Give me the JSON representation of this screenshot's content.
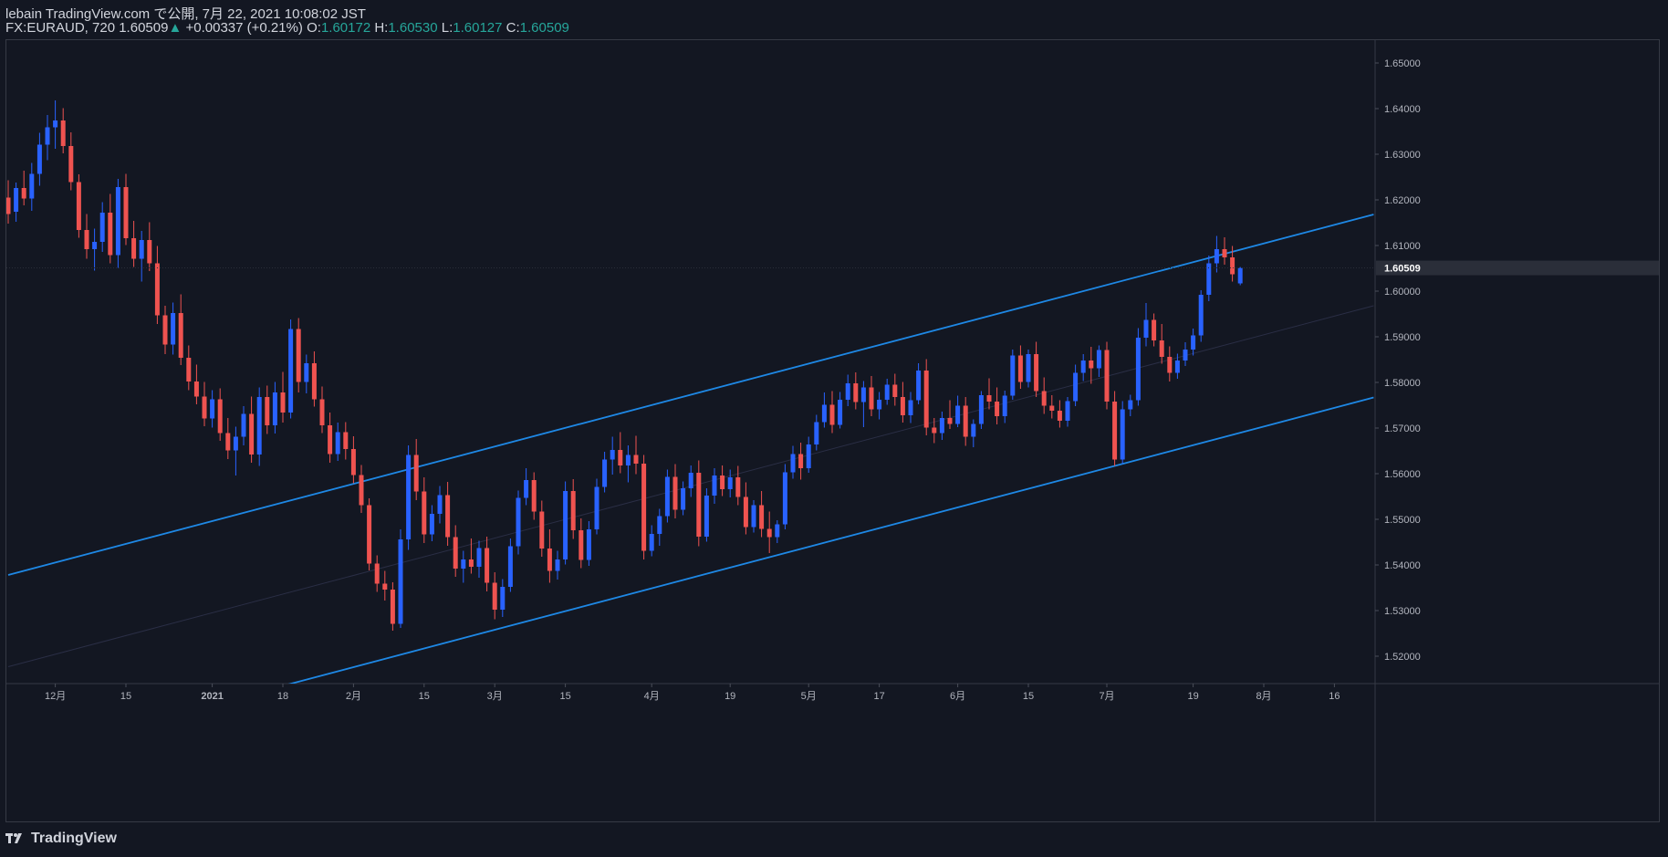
{
  "header": {
    "line1": "lebain TradingView.com で公開, 7月 22, 2021 10:08:02 JST",
    "symbol": "FX:EURAUD, 720",
    "last": "1.60509",
    "arrow": "▲",
    "change": "+0.00337 (+0.21%)",
    "o_label": "O:",
    "o_val": "1.60172",
    "h_label": "H:",
    "h_val": "1.60530",
    "l_label": "L:",
    "l_val": "1.60127",
    "c_label": "C:",
    "c_val": "1.60509"
  },
  "footer": {
    "brand": "TradingView"
  },
  "colors": {
    "background": "#131722",
    "up_candle": "#2962ff",
    "down_candle": "#ef5350",
    "channel": "#1e88e5",
    "price_badge": "#2a2e39"
  },
  "chart_data": {
    "type": "candlestick",
    "symbol": "FX:EURAUD",
    "interval": "720",
    "last_price": 1.60509,
    "y_range": [
      1.514,
      1.655
    ],
    "y_ticks": [
      "1.65000",
      "1.64000",
      "1.63000",
      "1.62000",
      "1.61000",
      "1.60000",
      "1.59000",
      "1.58000",
      "1.57000",
      "1.56000",
      "1.55000",
      "1.54000",
      "1.53000",
      "1.52000"
    ],
    "y_tick_values": [
      1.65,
      1.64,
      1.63,
      1.62,
      1.61,
      1.6,
      1.59,
      1.58,
      1.57,
      1.56,
      1.55,
      1.54,
      1.53,
      1.52
    ],
    "x_ticks": [
      {
        "label": "12月",
        "i": 6
      },
      {
        "label": "15",
        "i": 15
      },
      {
        "label": "2021",
        "i": 26
      },
      {
        "label": "18",
        "i": 35
      },
      {
        "label": "2月",
        "i": 44
      },
      {
        "label": "15",
        "i": 53
      },
      {
        "label": "3月",
        "i": 62
      },
      {
        "label": "15",
        "i": 71
      },
      {
        "label": "4月",
        "i": 82
      },
      {
        "label": "19",
        "i": 92
      },
      {
        "label": "5月",
        "i": 102
      },
      {
        "label": "17",
        "i": 111
      },
      {
        "label": "6月",
        "i": 121
      },
      {
        "label": "15",
        "i": 130
      },
      {
        "label": "7月",
        "i": 140
      },
      {
        "label": "19",
        "i": 151
      },
      {
        "label": "8月",
        "i": 160
      },
      {
        "label": "16",
        "i": 169
      }
    ],
    "bars": [
      [
        1.6205,
        1.6243,
        1.6148,
        1.6169
      ],
      [
        1.6174,
        1.6238,
        1.6152,
        1.6226
      ],
      [
        1.6226,
        1.6264,
        1.6188,
        1.6203
      ],
      [
        1.6203,
        1.6281,
        1.6176,
        1.6257
      ],
      [
        1.6257,
        1.6347,
        1.6231,
        1.6321
      ],
      [
        1.6321,
        1.6386,
        1.6287,
        1.6359
      ],
      [
        1.6359,
        1.6418,
        1.6312,
        1.6374
      ],
      [
        1.6374,
        1.6401,
        1.6302,
        1.6318
      ],
      [
        1.6318,
        1.6348,
        1.6221,
        1.6239
      ],
      [
        1.6239,
        1.6256,
        1.6117,
        1.6134
      ],
      [
        1.6134,
        1.6169,
        1.6071,
        1.6092
      ],
      [
        1.6092,
        1.6137,
        1.6045,
        1.6108
      ],
      [
        1.6108,
        1.6195,
        1.6086,
        1.6172
      ],
      [
        1.6172,
        1.6213,
        1.6061,
        1.6079
      ],
      [
        1.6079,
        1.6246,
        1.6051,
        1.6228
      ],
      [
        1.6228,
        1.6257,
        1.6101,
        1.6116
      ],
      [
        1.6116,
        1.6154,
        1.6053,
        1.6071
      ],
      [
        1.6071,
        1.6132,
        1.6021,
        1.6112
      ],
      [
        1.6112,
        1.6151,
        1.6044,
        1.6061
      ],
      [
        1.6061,
        1.6099,
        1.5928,
        1.5947
      ],
      [
        1.5947,
        1.5968,
        1.5862,
        1.5883
      ],
      [
        1.5883,
        1.5975,
        1.5861,
        1.5952
      ],
      [
        1.5952,
        1.5993,
        1.5838,
        1.5854
      ],
      [
        1.5854,
        1.5881,
        1.5783,
        1.5802
      ],
      [
        1.5802,
        1.5839,
        1.5752,
        1.5769
      ],
      [
        1.5769,
        1.5801,
        1.5704,
        1.5721
      ],
      [
        1.5721,
        1.5783,
        1.5701,
        1.5763
      ],
      [
        1.5763,
        1.5787,
        1.5672,
        1.5689
      ],
      [
        1.5689,
        1.5722,
        1.5632,
        1.5651
      ],
      [
        1.5651,
        1.5703,
        1.5596,
        1.5681
      ],
      [
        1.5681,
        1.5748,
        1.5662,
        1.5731
      ],
      [
        1.5731,
        1.5769,
        1.5624,
        1.5642
      ],
      [
        1.5642,
        1.5789,
        1.5617,
        1.5768
      ],
      [
        1.5768,
        1.5793,
        1.5687,
        1.5706
      ],
      [
        1.5706,
        1.5801,
        1.5688,
        1.5778
      ],
      [
        1.5778,
        1.5823,
        1.5712,
        1.5734
      ],
      [
        1.5734,
        1.5938,
        1.5721,
        1.5917
      ],
      [
        1.5917,
        1.5941,
        1.5778,
        1.5801
      ],
      [
        1.5801,
        1.5861,
        1.5776,
        1.5842
      ],
      [
        1.5842,
        1.5868,
        1.5747,
        1.5763
      ],
      [
        1.5763,
        1.5791,
        1.5689,
        1.5706
      ],
      [
        1.5706,
        1.5734,
        1.5624,
        1.5643
      ],
      [
        1.5643,
        1.5712,
        1.5628,
        1.5691
      ],
      [
        1.5691,
        1.5713,
        1.5631,
        1.5654
      ],
      [
        1.5654,
        1.5682,
        1.5579,
        1.5597
      ],
      [
        1.5597,
        1.5619,
        1.5514,
        1.5531
      ],
      [
        1.5531,
        1.5546,
        1.5388,
        1.5403
      ],
      [
        1.5403,
        1.5421,
        1.5341,
        1.5359
      ],
      [
        1.5359,
        1.5387,
        1.5322,
        1.5346
      ],
      [
        1.5346,
        1.5362,
        1.5256,
        1.5271
      ],
      [
        1.5271,
        1.5478,
        1.5262,
        1.5456
      ],
      [
        1.5456,
        1.5662,
        1.5433,
        1.5641
      ],
      [
        1.5641,
        1.5676,
        1.5542,
        1.5561
      ],
      [
        1.5561,
        1.5592,
        1.5448,
        1.5467
      ],
      [
        1.5467,
        1.5531,
        1.5452,
        1.5512
      ],
      [
        1.5512,
        1.5573,
        1.5491,
        1.5553
      ],
      [
        1.5553,
        1.5582,
        1.5442,
        1.5461
      ],
      [
        1.5461,
        1.5487,
        1.5374,
        1.5392
      ],
      [
        1.5392,
        1.5431,
        1.5361,
        1.5412
      ],
      [
        1.5412,
        1.5458,
        1.5381,
        1.5396
      ],
      [
        1.5396,
        1.5453,
        1.5372,
        1.5437
      ],
      [
        1.5437,
        1.5462,
        1.5342,
        1.5361
      ],
      [
        1.5361,
        1.5384,
        1.5281,
        1.5302
      ],
      [
        1.5302,
        1.5369,
        1.5286,
        1.5352
      ],
      [
        1.5352,
        1.5458,
        1.5341,
        1.5441
      ],
      [
        1.5441,
        1.5563,
        1.5423,
        1.5547
      ],
      [
        1.5547,
        1.5612,
        1.5531,
        1.5586
      ],
      [
        1.5586,
        1.5603,
        1.5499,
        1.5517
      ],
      [
        1.5517,
        1.5541,
        1.5418,
        1.5436
      ],
      [
        1.5436,
        1.5478,
        1.5361,
        1.5387
      ],
      [
        1.5387,
        1.5431,
        1.5368,
        1.5412
      ],
      [
        1.5412,
        1.5583,
        1.5401,
        1.5562
      ],
      [
        1.5562,
        1.5588,
        1.5457,
        1.5476
      ],
      [
        1.5476,
        1.5502,
        1.5393,
        1.5411
      ],
      [
        1.5411,
        1.5496,
        1.5398,
        1.5478
      ],
      [
        1.5478,
        1.5589,
        1.5467,
        1.5571
      ],
      [
        1.5571,
        1.5648,
        1.5559,
        1.5631
      ],
      [
        1.5631,
        1.5681,
        1.5598,
        1.5652
      ],
      [
        1.5652,
        1.5691,
        1.5601,
        1.5618
      ],
      [
        1.5618,
        1.5662,
        1.5581,
        1.5641
      ],
      [
        1.5641,
        1.5683,
        1.5599,
        1.5622
      ],
      [
        1.5622,
        1.5641,
        1.5412,
        1.5431
      ],
      [
        1.5431,
        1.5487,
        1.5419,
        1.5468
      ],
      [
        1.5468,
        1.5523,
        1.5442,
        1.5507
      ],
      [
        1.5507,
        1.5609,
        1.5493,
        1.5593
      ],
      [
        1.5593,
        1.5621,
        1.5502,
        1.5521
      ],
      [
        1.5521,
        1.5583,
        1.5509,
        1.5568
      ],
      [
        1.5568,
        1.5618,
        1.5549,
        1.5602
      ],
      [
        1.5602,
        1.5629,
        1.5441,
        1.5462
      ],
      [
        1.5462,
        1.5568,
        1.5451,
        1.5552
      ],
      [
        1.5552,
        1.5612,
        1.5534,
        1.5596
      ],
      [
        1.5596,
        1.5618,
        1.5551,
        1.5566
      ],
      [
        1.5566,
        1.5609,
        1.5548,
        1.5592
      ],
      [
        1.5592,
        1.5617,
        1.5531,
        1.5549
      ],
      [
        1.5549,
        1.5581,
        1.5467,
        1.5483
      ],
      [
        1.5483,
        1.5542,
        1.5471,
        1.5531
      ],
      [
        1.5531,
        1.5562,
        1.5461,
        1.5479
      ],
      [
        1.5479,
        1.5517,
        1.5426,
        1.5461
      ],
      [
        1.5461,
        1.5498,
        1.5448,
        1.5489
      ],
      [
        1.5489,
        1.5621,
        1.5478,
        1.5603
      ],
      [
        1.5603,
        1.5661,
        1.5589,
        1.5643
      ],
      [
        1.5643,
        1.5668,
        1.5587,
        1.5612
      ],
      [
        1.5612,
        1.5681,
        1.5602,
        1.5664
      ],
      [
        1.5664,
        1.5729,
        1.5651,
        1.5713
      ],
      [
        1.5713,
        1.5778,
        1.5701,
        1.5751
      ],
      [
        1.5751,
        1.5781,
        1.5689,
        1.5707
      ],
      [
        1.5707,
        1.5779,
        1.5699,
        1.5762
      ],
      [
        1.5762,
        1.5817,
        1.5748,
        1.5798
      ],
      [
        1.5798,
        1.5822,
        1.5741,
        1.5757
      ],
      [
        1.5757,
        1.5803,
        1.5702,
        1.5789
      ],
      [
        1.5789,
        1.5814,
        1.5726,
        1.5741
      ],
      [
        1.5741,
        1.5779,
        1.5719,
        1.5762
      ],
      [
        1.5762,
        1.5808,
        1.5751,
        1.5795
      ],
      [
        1.5795,
        1.5819,
        1.5749,
        1.5768
      ],
      [
        1.5768,
        1.5801,
        1.5712,
        1.5728
      ],
      [
        1.5728,
        1.5779,
        1.5711,
        1.5761
      ],
      [
        1.5761,
        1.5842,
        1.5752,
        1.5826
      ],
      [
        1.5826,
        1.5851,
        1.5684,
        1.5701
      ],
      [
        1.5701,
        1.5722,
        1.5667,
        1.5689
      ],
      [
        1.5689,
        1.5736,
        1.5674,
        1.5722
      ],
      [
        1.5722,
        1.5761,
        1.5698,
        1.5709
      ],
      [
        1.5709,
        1.5771,
        1.5702,
        1.5749
      ],
      [
        1.5749,
        1.5768,
        1.5661,
        1.5681
      ],
      [
        1.5681,
        1.5719,
        1.5658,
        1.5709
      ],
      [
        1.5709,
        1.5781,
        1.5698,
        1.5772
      ],
      [
        1.5772,
        1.5809,
        1.5741,
        1.5758
      ],
      [
        1.5758,
        1.5789,
        1.5708,
        1.5726
      ],
      [
        1.5726,
        1.5782,
        1.5711,
        1.5771
      ],
      [
        1.5771,
        1.5872,
        1.5762,
        1.5859
      ],
      [
        1.5859,
        1.5881,
        1.5786,
        1.5801
      ],
      [
        1.5801,
        1.5872,
        1.5789,
        1.5862
      ],
      [
        1.5862,
        1.5889,
        1.5768,
        1.5781
      ],
      [
        1.5781,
        1.5811,
        1.5731,
        1.5749
      ],
      [
        1.5749,
        1.5772,
        1.5721,
        1.5738
      ],
      [
        1.5738,
        1.5761,
        1.5701,
        1.5716
      ],
      [
        1.5716,
        1.5768,
        1.5703,
        1.5759
      ],
      [
        1.5759,
        1.5839,
        1.5748,
        1.5821
      ],
      [
        1.5821,
        1.5862,
        1.5803,
        1.5848
      ],
      [
        1.5848,
        1.5878,
        1.5797,
        1.5831
      ],
      [
        1.5831,
        1.5881,
        1.5812,
        1.5871
      ],
      [
        1.5871,
        1.5889,
        1.5741,
        1.5758
      ],
      [
        1.5758,
        1.5781,
        1.5617,
        1.5631
      ],
      [
        1.5631,
        1.5759,
        1.5621,
        1.5741
      ],
      [
        1.5741,
        1.5773,
        1.5726,
        1.5761
      ],
      [
        1.5761,
        1.5919,
        1.5749,
        1.5898
      ],
      [
        1.5898,
        1.5974,
        1.5879,
        1.5937
      ],
      [
        1.5937,
        1.5951,
        1.5879,
        1.5892
      ],
      [
        1.5892,
        1.5928,
        1.5841,
        1.5856
      ],
      [
        1.5856,
        1.5879,
        1.5802,
        1.5821
      ],
      [
        1.5821,
        1.5863,
        1.5808,
        1.5848
      ],
      [
        1.5848,
        1.5888,
        1.5836,
        1.5872
      ],
      [
        1.5872,
        1.5918,
        1.5859,
        1.5903
      ],
      [
        1.5903,
        1.6002,
        1.5889,
        1.5992
      ],
      [
        1.5992,
        1.6078,
        1.5978,
        1.6061
      ],
      [
        1.6061,
        1.6121,
        1.6041,
        1.6092
      ],
      [
        1.6092,
        1.6118,
        1.6058,
        1.6074
      ],
      [
        1.6074,
        1.6099,
        1.6021,
        1.6037
      ],
      [
        1.6017,
        1.6053,
        1.6013,
        1.6051
      ]
    ],
    "channel": {
      "upper": {
        "i1": 0,
        "p1": 1.5378,
        "i2": 174,
        "p2": 1.6168
      },
      "middle": {
        "i1": 0,
        "p1": 1.5177,
        "i2": 174,
        "p2": 1.5968
      },
      "lower": {
        "i1": 0,
        "p1": 1.4976,
        "i2": 174,
        "p2": 1.5767
      }
    }
  }
}
